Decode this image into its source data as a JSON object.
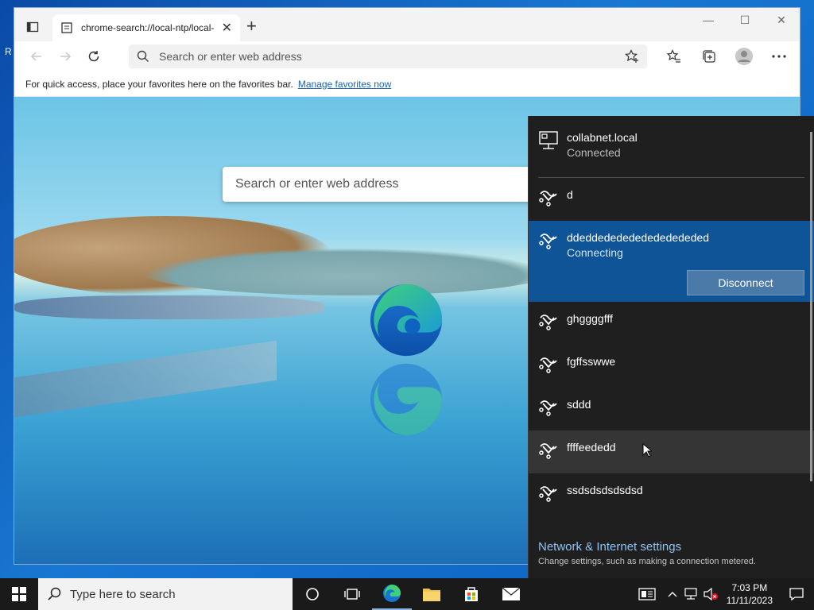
{
  "desktop": {
    "edge_text": "R"
  },
  "browser": {
    "tab_title": "chrome-search://local-ntp/local-",
    "close_glyph": "✕",
    "newtab_glyph": "+",
    "address_placeholder": "Search or enter web address",
    "favbar_text": "For quick access, place your favorites here on the favorites bar.",
    "favbar_link": "Manage favorites now",
    "page_search_placeholder": "Search or enter web address"
  },
  "flyout": {
    "connected": {
      "name": "collabnet.local",
      "status": "Connected"
    },
    "networks": [
      {
        "name": "d"
      },
      {
        "name": "ddeddededededededededed",
        "status": "Connecting",
        "button": "Disconnect"
      },
      {
        "name": "ghggggfff"
      },
      {
        "name": "fgffsswwe"
      },
      {
        "name": "sddd"
      },
      {
        "name": "ffffeededd"
      },
      {
        "name": "ssdsdsdsdsdsd"
      }
    ],
    "settings_title": "Network & Internet settings",
    "settings_desc": "Change settings, such as making a connection metered."
  },
  "taskbar": {
    "search_placeholder": "Type here to search",
    "time": "7:03 PM",
    "date": "11/11/2023"
  },
  "colors": {
    "accent": "#0f5496",
    "flyout_bg": "#1f1f1f",
    "link": "#8fc3f5"
  }
}
